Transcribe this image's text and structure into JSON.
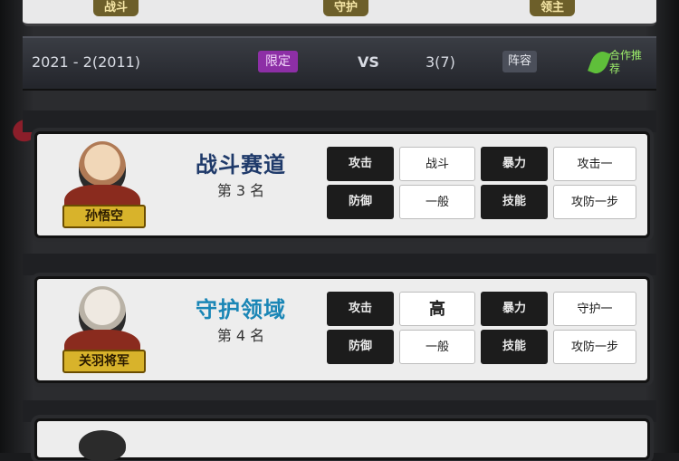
{
  "top": {
    "badges": [
      "战斗",
      "守护",
      "领主"
    ]
  },
  "info": {
    "time_text": "2021 - 2(2011)",
    "tag": "限定",
    "vs": "VS",
    "count_text": "3(7)",
    "mini_tag": "阵容",
    "green_text": "合作推荐"
  },
  "cards": [
    {
      "name_tag": "孙悟空",
      "role_name": "战斗赛道",
      "role_color": "#1f3a6a",
      "level": "第 3 名",
      "stats": [
        {
          "k": "攻击",
          "v": "战斗"
        },
        {
          "k": "暴力",
          "v": "攻击一"
        },
        {
          "k": "防御",
          "v": "一般"
        },
        {
          "k": "技能",
          "v": "攻防一步"
        }
      ]
    },
    {
      "name_tag": "关羽将军",
      "role_name": "守护领域",
      "role_color": "#1a86b6",
      "level": "第 4 名",
      "stats": [
        {
          "k": "攻击",
          "v": "高"
        },
        {
          "k": "暴力",
          "v": "守护一"
        },
        {
          "k": "防御",
          "v": "一般"
        },
        {
          "k": "技能",
          "v": "攻防一步"
        }
      ]
    },
    {
      "name_tag": "",
      "role_name": "",
      "role_color": "#1a86b6",
      "level": "",
      "stats": []
    }
  ]
}
